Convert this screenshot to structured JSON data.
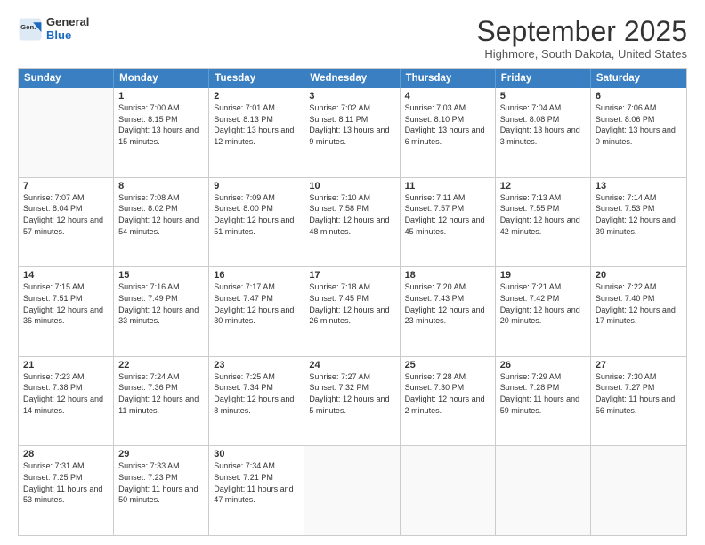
{
  "logo": {
    "general": "General",
    "blue": "Blue"
  },
  "header": {
    "month": "September 2025",
    "location": "Highmore, South Dakota, United States"
  },
  "days": [
    "Sunday",
    "Monday",
    "Tuesday",
    "Wednesday",
    "Thursday",
    "Friday",
    "Saturday"
  ],
  "rows": [
    [
      {
        "day": "",
        "empty": true
      },
      {
        "day": "1",
        "sunrise": "Sunrise: 7:00 AM",
        "sunset": "Sunset: 8:15 PM",
        "daylight": "Daylight: 13 hours and 15 minutes."
      },
      {
        "day": "2",
        "sunrise": "Sunrise: 7:01 AM",
        "sunset": "Sunset: 8:13 PM",
        "daylight": "Daylight: 13 hours and 12 minutes."
      },
      {
        "day": "3",
        "sunrise": "Sunrise: 7:02 AM",
        "sunset": "Sunset: 8:11 PM",
        "daylight": "Daylight: 13 hours and 9 minutes."
      },
      {
        "day": "4",
        "sunrise": "Sunrise: 7:03 AM",
        "sunset": "Sunset: 8:10 PM",
        "daylight": "Daylight: 13 hours and 6 minutes."
      },
      {
        "day": "5",
        "sunrise": "Sunrise: 7:04 AM",
        "sunset": "Sunset: 8:08 PM",
        "daylight": "Daylight: 13 hours and 3 minutes."
      },
      {
        "day": "6",
        "sunrise": "Sunrise: 7:06 AM",
        "sunset": "Sunset: 8:06 PM",
        "daylight": "Daylight: 13 hours and 0 minutes."
      }
    ],
    [
      {
        "day": "7",
        "sunrise": "Sunrise: 7:07 AM",
        "sunset": "Sunset: 8:04 PM",
        "daylight": "Daylight: 12 hours and 57 minutes."
      },
      {
        "day": "8",
        "sunrise": "Sunrise: 7:08 AM",
        "sunset": "Sunset: 8:02 PM",
        "daylight": "Daylight: 12 hours and 54 minutes."
      },
      {
        "day": "9",
        "sunrise": "Sunrise: 7:09 AM",
        "sunset": "Sunset: 8:00 PM",
        "daylight": "Daylight: 12 hours and 51 minutes."
      },
      {
        "day": "10",
        "sunrise": "Sunrise: 7:10 AM",
        "sunset": "Sunset: 7:58 PM",
        "daylight": "Daylight: 12 hours and 48 minutes."
      },
      {
        "day": "11",
        "sunrise": "Sunrise: 7:11 AM",
        "sunset": "Sunset: 7:57 PM",
        "daylight": "Daylight: 12 hours and 45 minutes."
      },
      {
        "day": "12",
        "sunrise": "Sunrise: 7:13 AM",
        "sunset": "Sunset: 7:55 PM",
        "daylight": "Daylight: 12 hours and 42 minutes."
      },
      {
        "day": "13",
        "sunrise": "Sunrise: 7:14 AM",
        "sunset": "Sunset: 7:53 PM",
        "daylight": "Daylight: 12 hours and 39 minutes."
      }
    ],
    [
      {
        "day": "14",
        "sunrise": "Sunrise: 7:15 AM",
        "sunset": "Sunset: 7:51 PM",
        "daylight": "Daylight: 12 hours and 36 minutes."
      },
      {
        "day": "15",
        "sunrise": "Sunrise: 7:16 AM",
        "sunset": "Sunset: 7:49 PM",
        "daylight": "Daylight: 12 hours and 33 minutes."
      },
      {
        "day": "16",
        "sunrise": "Sunrise: 7:17 AM",
        "sunset": "Sunset: 7:47 PM",
        "daylight": "Daylight: 12 hours and 30 minutes."
      },
      {
        "day": "17",
        "sunrise": "Sunrise: 7:18 AM",
        "sunset": "Sunset: 7:45 PM",
        "daylight": "Daylight: 12 hours and 26 minutes."
      },
      {
        "day": "18",
        "sunrise": "Sunrise: 7:20 AM",
        "sunset": "Sunset: 7:43 PM",
        "daylight": "Daylight: 12 hours and 23 minutes."
      },
      {
        "day": "19",
        "sunrise": "Sunrise: 7:21 AM",
        "sunset": "Sunset: 7:42 PM",
        "daylight": "Daylight: 12 hours and 20 minutes."
      },
      {
        "day": "20",
        "sunrise": "Sunrise: 7:22 AM",
        "sunset": "Sunset: 7:40 PM",
        "daylight": "Daylight: 12 hours and 17 minutes."
      }
    ],
    [
      {
        "day": "21",
        "sunrise": "Sunrise: 7:23 AM",
        "sunset": "Sunset: 7:38 PM",
        "daylight": "Daylight: 12 hours and 14 minutes."
      },
      {
        "day": "22",
        "sunrise": "Sunrise: 7:24 AM",
        "sunset": "Sunset: 7:36 PM",
        "daylight": "Daylight: 12 hours and 11 minutes."
      },
      {
        "day": "23",
        "sunrise": "Sunrise: 7:25 AM",
        "sunset": "Sunset: 7:34 PM",
        "daylight": "Daylight: 12 hours and 8 minutes."
      },
      {
        "day": "24",
        "sunrise": "Sunrise: 7:27 AM",
        "sunset": "Sunset: 7:32 PM",
        "daylight": "Daylight: 12 hours and 5 minutes."
      },
      {
        "day": "25",
        "sunrise": "Sunrise: 7:28 AM",
        "sunset": "Sunset: 7:30 PM",
        "daylight": "Daylight: 12 hours and 2 minutes."
      },
      {
        "day": "26",
        "sunrise": "Sunrise: 7:29 AM",
        "sunset": "Sunset: 7:28 PM",
        "daylight": "Daylight: 11 hours and 59 minutes."
      },
      {
        "day": "27",
        "sunrise": "Sunrise: 7:30 AM",
        "sunset": "Sunset: 7:27 PM",
        "daylight": "Daylight: 11 hours and 56 minutes."
      }
    ],
    [
      {
        "day": "28",
        "sunrise": "Sunrise: 7:31 AM",
        "sunset": "Sunset: 7:25 PM",
        "daylight": "Daylight: 11 hours and 53 minutes."
      },
      {
        "day": "29",
        "sunrise": "Sunrise: 7:33 AM",
        "sunset": "Sunset: 7:23 PM",
        "daylight": "Daylight: 11 hours and 50 minutes."
      },
      {
        "day": "30",
        "sunrise": "Sunrise: 7:34 AM",
        "sunset": "Sunset: 7:21 PM",
        "daylight": "Daylight: 11 hours and 47 minutes."
      },
      {
        "day": "",
        "empty": true
      },
      {
        "day": "",
        "empty": true
      },
      {
        "day": "",
        "empty": true
      },
      {
        "day": "",
        "empty": true
      }
    ]
  ]
}
